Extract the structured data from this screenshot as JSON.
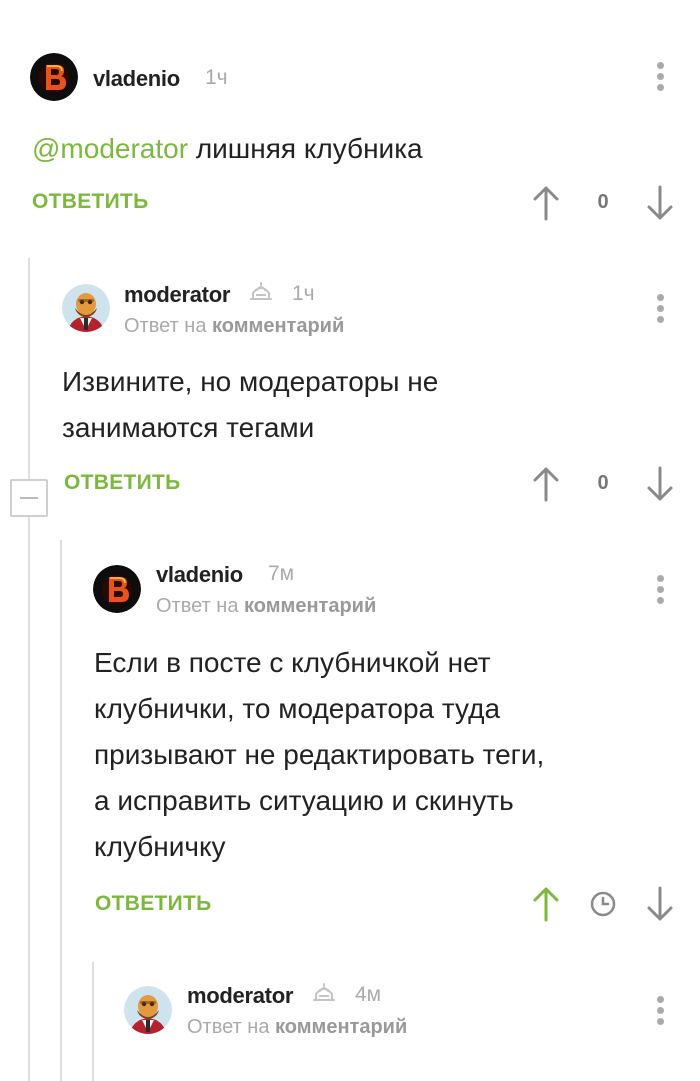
{
  "comments": [
    {
      "username": "vladenio",
      "time": "1ч",
      "mention": "@moderator",
      "text": " лишняя клубника",
      "reply_label": "ОТВЕТИТЬ",
      "rating": "0"
    },
    {
      "username": "moderator",
      "time": "1ч",
      "reply_prefix": "Ответ на",
      "reply_target": "комментарий",
      "text_lines": [
        "Извините, но модераторы не",
        "занимаются тегами"
      ],
      "reply_label": "ОТВЕТИТЬ",
      "rating": "0"
    },
    {
      "username": "vladenio",
      "time": "7м",
      "reply_prefix": "Ответ на",
      "reply_target": "комментарий",
      "text_lines": [
        "Если в посте с клубничкой нет",
        "клубнички, то модератора туда",
        "призывают не редактировать теги,",
        "а исправить ситуацию и скинуть",
        "клубничку"
      ],
      "reply_label": "ОТВЕТИТЬ"
    },
    {
      "username": "moderator",
      "time": "4м",
      "reply_prefix": "Ответ на",
      "reply_target": "комментарий"
    }
  ],
  "icons": {
    "vote_up": "arrow-up-icon",
    "vote_down": "arrow-down-icon",
    "menu": "more-vertical-icon",
    "moderator_badge": "moderator-hat-icon",
    "pending_rating": "clock-icon",
    "collapse": "minus-icon"
  },
  "colors": {
    "accent": "#7cb83e",
    "muted": "#aaaaaa",
    "thread_line": "#dedede"
  }
}
